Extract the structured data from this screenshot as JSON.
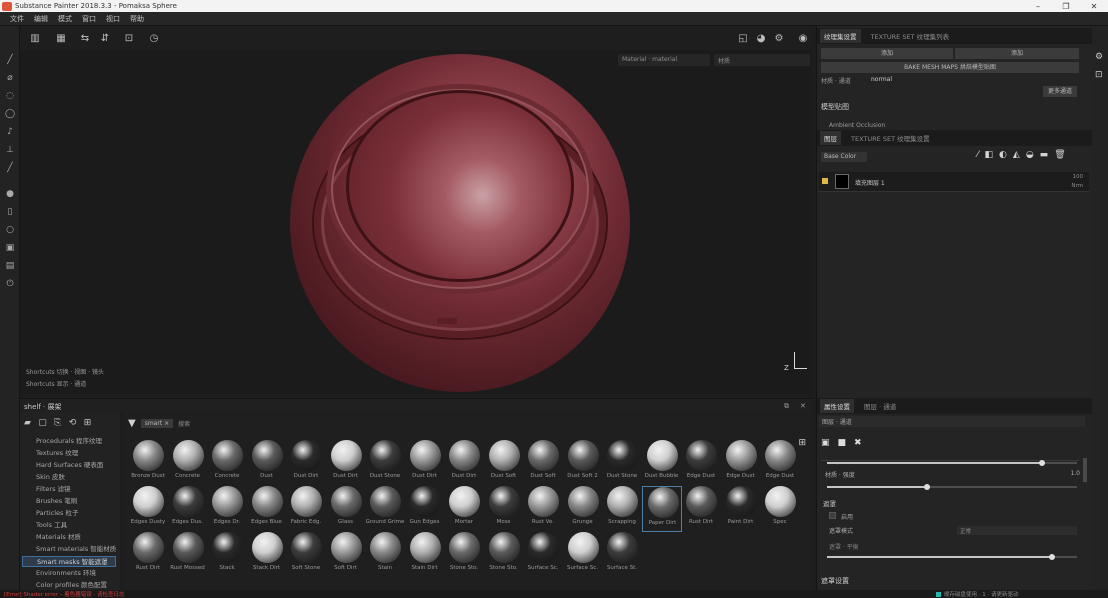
{
  "window": {
    "title": "Substance Painter 2018.3.3 - Pomaksa Sphere"
  },
  "menu": [
    "文件",
    "编辑",
    "模式",
    "窗口",
    "视口",
    "帮助"
  ],
  "viewport": {
    "dropdown1": "Material · material",
    "dropdown2": "材质",
    "info_line1": "Shortcuts 切换 · 视图 · 镜头",
    "info_line2": "Shortcuts 显示 · 通道"
  },
  "shelf": {
    "title": "shelf · 展架",
    "search_placeholder": "搜索",
    "filter_chip": "smart ×",
    "categories": [
      "Procedurals 程序纹理",
      "Textures 纹理",
      "Hard Surfaces 硬表面",
      "Skin 皮肤",
      "Filters 滤镜",
      "Brushes 笔刷",
      "Particles 粒子",
      "Tools 工具",
      "Materials 材质",
      "Smart materials 智能材质",
      "Smart masks 智能遮罩",
      "Environments 环境",
      "Color profiles 颜色配置"
    ],
    "selected_category_index": 10,
    "materials_row1": [
      "Bronze Dust",
      "Concrete",
      "Concrete",
      "Dust",
      "Dust Dirt",
      "Dust Dirt",
      "Dust Stone",
      "Dust Dirt",
      "Dust Dirt",
      "Dust Soft",
      "Dust Soft",
      "Dust Soft 2",
      "Dust Stone",
      "Dust Bubble",
      "Edge Dust",
      "Edge Dust",
      "Edge Dust"
    ],
    "materials_row2": [
      "Edges Dusty",
      "Edges Dus.",
      "Edges Dr.",
      "Edges Blue",
      "Fabric Edg.",
      "Glass",
      "Ground Grime",
      "Gun Edges",
      "Mortar",
      "Moss",
      "Rust Ve.",
      "Grunge",
      "Scrapping",
      "Paper Dirt",
      "Rust Dirt",
      "Paint Dirt",
      "Spec"
    ],
    "materials_row3": [
      "Rust Dirt",
      "Rust Mossed",
      "Stack",
      "Stack Dirt",
      "Soft Stone",
      "Soft Dirt",
      "Stain",
      "Stain Dirt",
      "Stone Sto.",
      "Stone Sto.",
      "Surface Sc.",
      "Surface Sc.",
      "Surface St."
    ],
    "selected_material": "Paper Dirt"
  },
  "texture_set_panel": {
    "tabs": [
      "纹理集设置",
      "TEXTURE SET 纹理集列表"
    ],
    "btn_left": "添加",
    "btn_right": "添加",
    "wide_btn": "BAKE MESH MAPS 烘焙模型贴图",
    "field_label": "材质 · 通道",
    "field_value": "normal",
    "right_link": "更多通道",
    "section": "模型贴图",
    "item": "Ambient Occlusion"
  },
  "layers_panel": {
    "tabs": [
      "图层",
      "TEXTURE SET 纹理集设置"
    ],
    "blend_mode": "Base Color",
    "layer_name": "填充图层 1",
    "layer_opacity": "100",
    "layer_blend": "Nrm"
  },
  "properties_panel": {
    "tabs": [
      "属性设置",
      "图层 · 通道"
    ],
    "dropdown": "图层 · 通道",
    "section1": "属性",
    "slider1_label": "材质 · 强度",
    "slider1_value": "1.0",
    "slider1_fill": 0.86,
    "slider2_fill": 0.4,
    "group_label": "遮罩",
    "checkbox_label": "启用",
    "field2_label": "遮罩模式",
    "field2_value": "正常",
    "slider3_label": "遮罩 · 平衡",
    "slider3_fill": 0.9,
    "bottom_section": "遮罩设置"
  },
  "status": {
    "error_text": "[Error] Shader error – 着色器错误 · 请检查日志",
    "right_text": "缓存磁盘使用 · 1  ·  请更新驱动"
  },
  "colors": {
    "accent": "#4d7ea8",
    "error": "#d33c3c",
    "status_ok": "#26b8b0"
  }
}
